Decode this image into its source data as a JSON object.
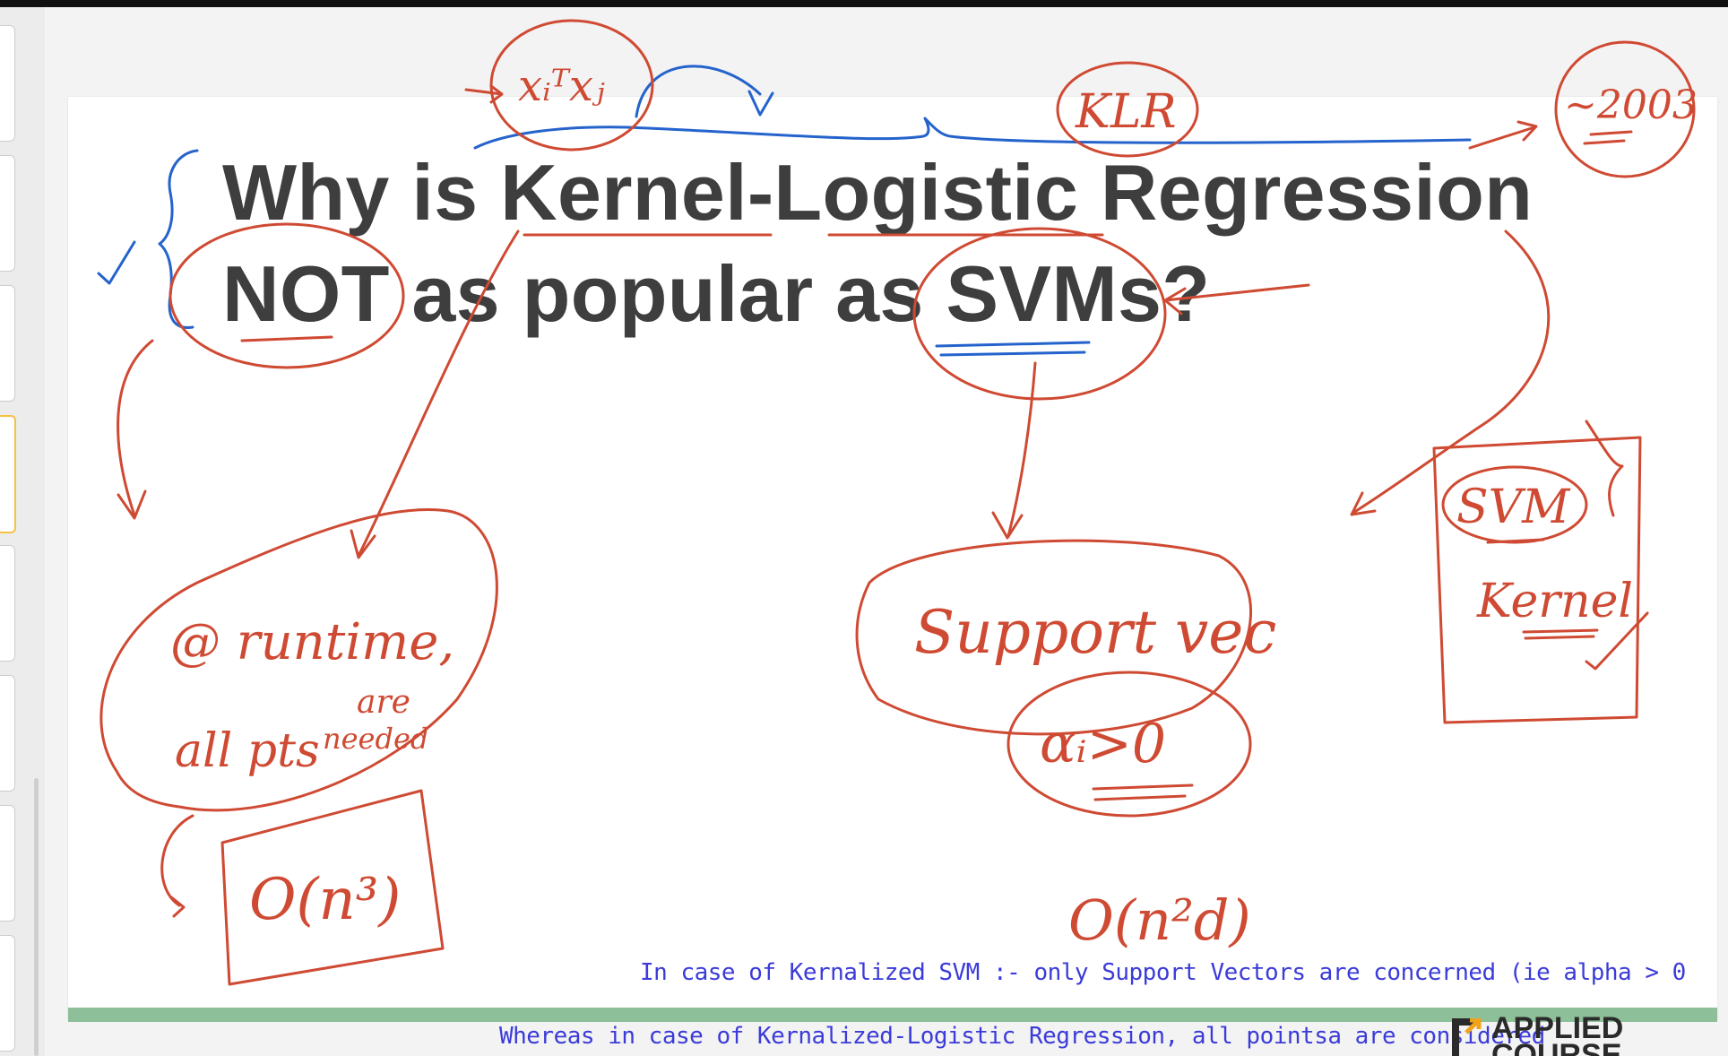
{
  "slide": {
    "title_line_1": "Why is Kernel-Logistic Regression",
    "title_line_2": "NOT as popular as SVMs?"
  },
  "annotations": {
    "xi_xj": "xᵢᵀxⱼ",
    "klr": "KLR",
    "year": "~2003",
    "runtime_line_1": "@ runtime,",
    "runtime_line_2": "all pts",
    "runtime_line_3": "are",
    "runtime_line_4": "needed",
    "complexity_n3": "O(n³)",
    "support_vectors": "Support vec",
    "alpha_condition": "αᵢ>0",
    "complexity_n2d": "O(n²d)",
    "svm_label": "SVM",
    "kernel_label": "Kernel"
  },
  "captions": {
    "line_1": "In case of Kernalized SVM :- only Support Vectors are concerned (ie alpha > 0",
    "line_2": "Whereas in case of Kernalized-Logistic Regression, all pointsa are considered"
  },
  "logo": {
    "line_1": "APPLIED",
    "line_2": "COURSE"
  },
  "colors": {
    "title_text": "#3e3e3e",
    "red_ink": "#cf4a33",
    "blue_ink": "#2563cc",
    "caption_text": "#3b3bd9",
    "slide_bottom_bar": "#8dbf98",
    "logo_accent": "#f0a21b"
  }
}
